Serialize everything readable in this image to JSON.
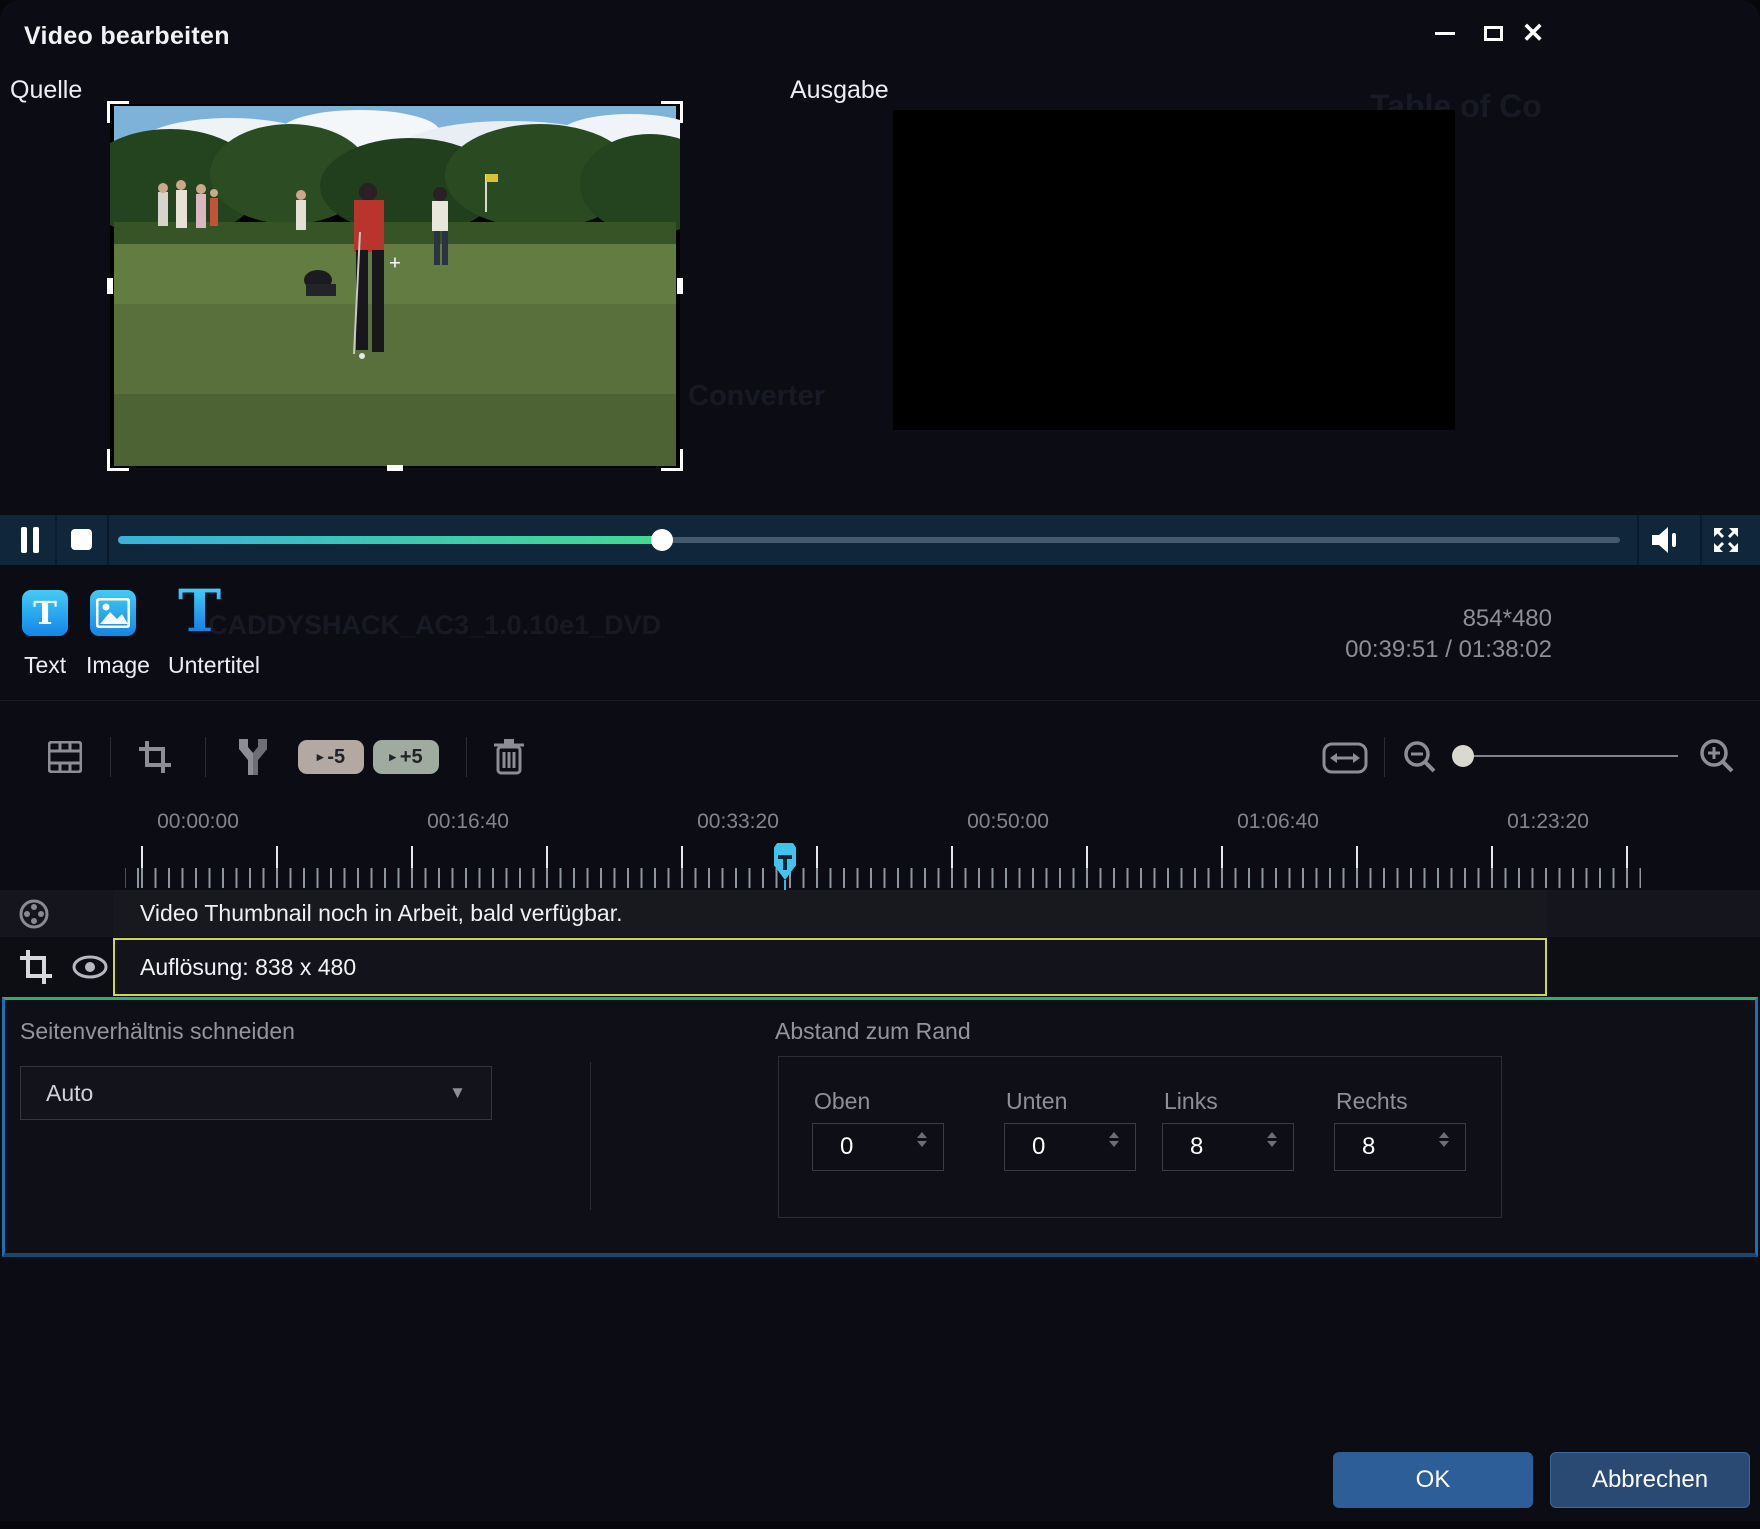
{
  "window": {
    "title": "Video bearbeiten",
    "minimize_label": "minimize",
    "maximize_label": "maximize",
    "close_label": "close"
  },
  "previews": {
    "source_label": "Quelle",
    "output_label": "Ausgabe",
    "crosshair": "+"
  },
  "overlay_tools": {
    "text_label": "Text",
    "text_glyph": "T",
    "image_label": "Image",
    "subtitle_label": "Untertitel",
    "subtitle_glyph": "T"
  },
  "media_info": {
    "resolution": "854*480",
    "time": "00:39:51 / 01:38:02"
  },
  "edit_toolbar": {
    "skip_back_label": "-5",
    "skip_fwd_label": "+5",
    "skip_play_glyph": "▸"
  },
  "timeline": {
    "timestamps": [
      "00:00:00",
      "00:16:40",
      "00:33:20",
      "00:50:00",
      "01:06:40",
      "01:23:20"
    ],
    "thumbnail_notice": "Video Thumbnail noch in Arbeit, bald verfügbar.",
    "subtitle_track_text": "Auflösung: 838 x 480"
  },
  "crop_panel": {
    "aspect_heading": "Seitenverhältnis schneiden",
    "aspect_value": "Auto",
    "aspect_caret": "▼",
    "margin_heading": "Abstand zum Rand",
    "fields": [
      {
        "label": "Oben",
        "value": "0"
      },
      {
        "label": "Unten",
        "value": "0"
      },
      {
        "label": "Links",
        "value": "8"
      },
      {
        "label": "Rechts",
        "value": "8"
      }
    ]
  },
  "actions": {
    "ok": "OK",
    "cancel": "Abbrechen"
  },
  "icons": [
    "pause-icon",
    "stop-icon",
    "volume-icon",
    "fullscreen-icon",
    "text-chip-icon",
    "image-chip-icon",
    "subtitle-t-icon",
    "film-frames-icon",
    "crop-icon",
    "split-icon",
    "trash-icon",
    "fit-width-icon",
    "zoom-out-icon",
    "zoom-in-icon",
    "film-reel-icon",
    "crop-track-icon",
    "eye-icon"
  ],
  "colors": {
    "accent_cyan": "#35b9e2",
    "progress_start": "#35b4d9",
    "progress_end": "#3fdd8e",
    "chip_blue_top": "#41ccf8",
    "chip_blue_bottom": "#1286e6",
    "subtitle_border_yellow": "#ccd84c",
    "panel_top_green": "#2fae6e",
    "panel_side_blue": "#1d6fae",
    "ok_button_blue": "#2e5e97"
  },
  "background_artifacts": {
    "a1": "Table of Co",
    "a2": "CADDYSHACK_AC3_1.0.10e1_DVD",
    "a3": "Converter"
  }
}
